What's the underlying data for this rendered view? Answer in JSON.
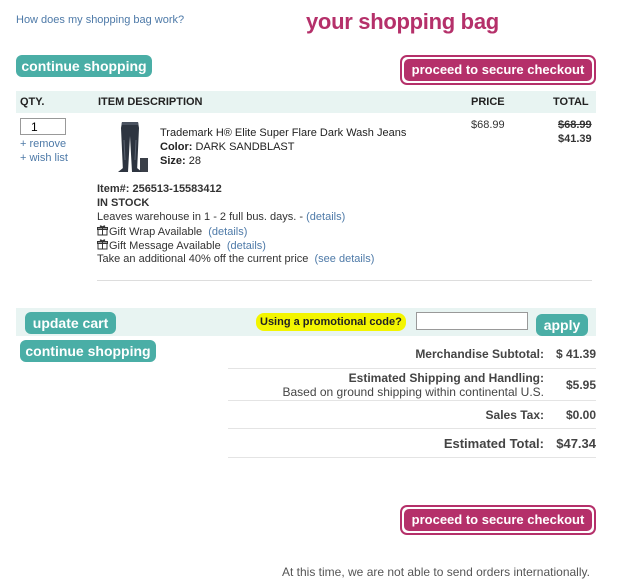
{
  "header": {
    "help_link": "How does my shopping bag work?",
    "title": "your shopping bag"
  },
  "buttons": {
    "continue_shopping": "continue shopping",
    "checkout": "proceed to secure checkout",
    "update_cart": "update cart",
    "apply": "apply"
  },
  "table": {
    "headers": {
      "qty": "QTY.",
      "description": "ITEM DESCRIPTION",
      "price": "PRICE",
      "total": "TOTAL"
    }
  },
  "item": {
    "qty": "1",
    "remove_link": "+ remove",
    "wishlist_link": "+ wish list",
    "title": "Trademark H® Elite Super Flare Dark Wash Jeans",
    "color_label": "Color:",
    "color_value": "DARK SANDBLAST",
    "size_label": "Size:",
    "size_value": "28",
    "price": "$68.99",
    "total_original": "$68.99",
    "total_discounted": "$41.39",
    "item_number": "Item#: 256513-15583412",
    "stock_status": "IN STOCK",
    "shipping_note": "Leaves warehouse in 1 - 2 full bus. days. - ",
    "shipping_details_link": "(details)",
    "gift_wrap": "Gift Wrap Available",
    "gift_wrap_link": "(details)",
    "gift_message": "Gift Message Available",
    "gift_message_link": "(details)",
    "promo_note": "Take an additional 40% off the current price",
    "promo_note_link": "(see details)"
  },
  "promo": {
    "label": "Using a promotional code?",
    "input_value": ""
  },
  "summary": {
    "subtotal_label": "Merchandise Subtotal:",
    "subtotal_value": "$ 41.39",
    "shipping_label": "Estimated Shipping and Handling:",
    "shipping_sub": "Based on ground shipping within continental U.S.",
    "shipping_value": "$5.95",
    "tax_label": "Sales Tax:",
    "tax_value": "$0.00",
    "total_label": "Estimated Total:",
    "total_value": "$47.34"
  },
  "footer": {
    "international_note": "At this time, we are not able to send orders internationally."
  },
  "colors": {
    "brand_pink": "#b5306a",
    "teal": "#4aaea6",
    "link_blue": "#4e7aa8",
    "highlight_yellow": "#f3f500"
  }
}
